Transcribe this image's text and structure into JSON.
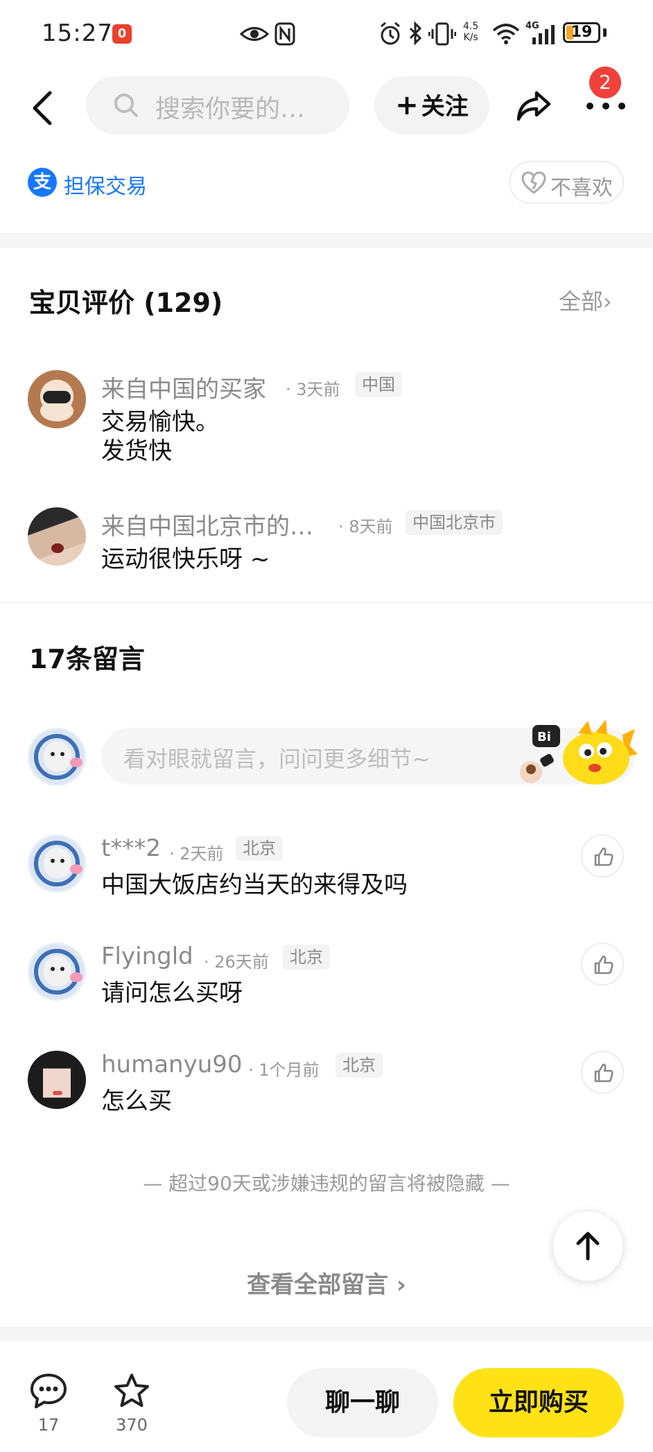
{
  "status_bar": {
    "time": "15:27",
    "notif_count": "0",
    "net_speed_top": "4.5",
    "net_speed_bottom": "K/s",
    "signal_label": "4G",
    "battery": "19"
  },
  "top_nav": {
    "search_placeholder": "搜索你要的…",
    "follow_label": "关注",
    "notification_count": "2"
  },
  "guarantee": {
    "label": "担保交易",
    "alipay_glyph": "支",
    "dislike_label": "不喜欢"
  },
  "reviews": {
    "title": "宝贝评价 (129)",
    "see_all": "全部",
    "items": [
      {
        "name": "来自中国的买家",
        "time": "· 3天前",
        "location": "中国",
        "line1": "交易愉快。",
        "line2": "发货快"
      },
      {
        "name": "来自中国北京市的…",
        "time": "· 8天前",
        "location": "中国北京市",
        "line1": "运动很快乐呀 ~"
      }
    ]
  },
  "comments": {
    "title": "17条留言",
    "input_placeholder": "看对眼就留言，问问更多细节~",
    "mascot_bubble": "Bi",
    "items": [
      {
        "name": "t***2",
        "time": "· 2天前",
        "location": "北京",
        "text": "中国大饭店约当天的来得及吗"
      },
      {
        "name": "Flyingld",
        "time": "· 26天前",
        "location": "北京",
        "text": "请问怎么买呀"
      },
      {
        "name": "humanyu90",
        "time": "· 1个月前",
        "location": "北京",
        "text": "怎么买"
      }
    ],
    "hidden_note": "— 超过90天或涉嫌违规的留言将被隐藏 —",
    "view_all": "查看全部留言"
  },
  "bottom_bar": {
    "comment_count": "17",
    "favorite_count": "370",
    "chat_label": "聊一聊",
    "buy_label": "立即购买"
  },
  "colors": {
    "accent_yellow": "#ffe215",
    "alipay_blue": "#1677ff",
    "badge_red": "#f0403a"
  }
}
